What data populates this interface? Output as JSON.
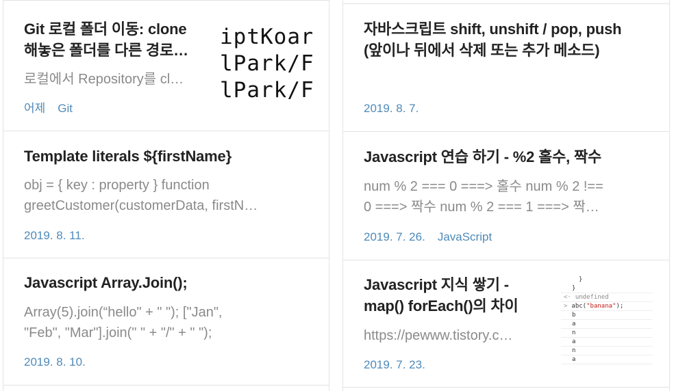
{
  "left_column": [
    {
      "title": "Git 로컬 폴더 이동: clone 해놓은 폴더를 다른 경로…",
      "title_line1": "Git 로컬 폴더 이동: clone",
      "title_line2": "해놓은 폴더를 다른 경로…",
      "excerpt": "로컬에서 Repository를 cl…",
      "date": "어제",
      "category": "Git",
      "thumbnail_lines": [
        "iptKoar",
        "lPark/F",
        "lPark/F"
      ]
    },
    {
      "title": "Template literals ${firstName}",
      "excerpt_line1": "obj = { key : property } function",
      "excerpt_line2": "greetCustomer(customerData, firstN…",
      "date": "2019. 8. 11."
    },
    {
      "title": "Javascript Array.Join();",
      "excerpt_line1": "Array(5).join(“hello\" + \" \"); [\"Jan\",",
      "excerpt_line2": "\"Feb\", \"Mar\"].join(\" \" + \"/\" + \" \");",
      "date": "2019. 8. 10."
    }
  ],
  "right_column": [
    {
      "title_line1": "자바스크립트 shift, unshift / pop, push",
      "title_line2": "(앞이나 뒤에서 삭제 또는 추가 메소드)",
      "date": "2019. 8. 7."
    },
    {
      "title": "Javascript 연습 하기 - %2 홀수, 짝수",
      "excerpt_line1": "num % 2 === 0 ===> 홀수 num % 2 !==",
      "excerpt_line2": "0 ===> 짝수 num % 2 === 1 ===> 짝…",
      "date": "2019. 7. 26.",
      "category": "JavaScript"
    },
    {
      "title_line1": "Javascript 지식 쌓기 -",
      "title_line2": "map() forEach()의 차이",
      "excerpt": "https://pewww.tistory.c…",
      "date": "2019. 7. 23.",
      "console": {
        "line1": "}",
        "line2": "}",
        "undefined_arrow": "<·",
        "undefined_text": "undefined",
        "call_arrow": ">",
        "call_prefix": "abc(",
        "call_arg": "\"banana\"",
        "call_suffix": ");",
        "output": [
          "b",
          "a",
          "n",
          "a",
          "n",
          "a"
        ]
      }
    }
  ],
  "colors": {
    "title": "#222222",
    "excerpt": "#8a8a8a",
    "meta": "#4f8ab8",
    "border": "#e3e3e3"
  }
}
